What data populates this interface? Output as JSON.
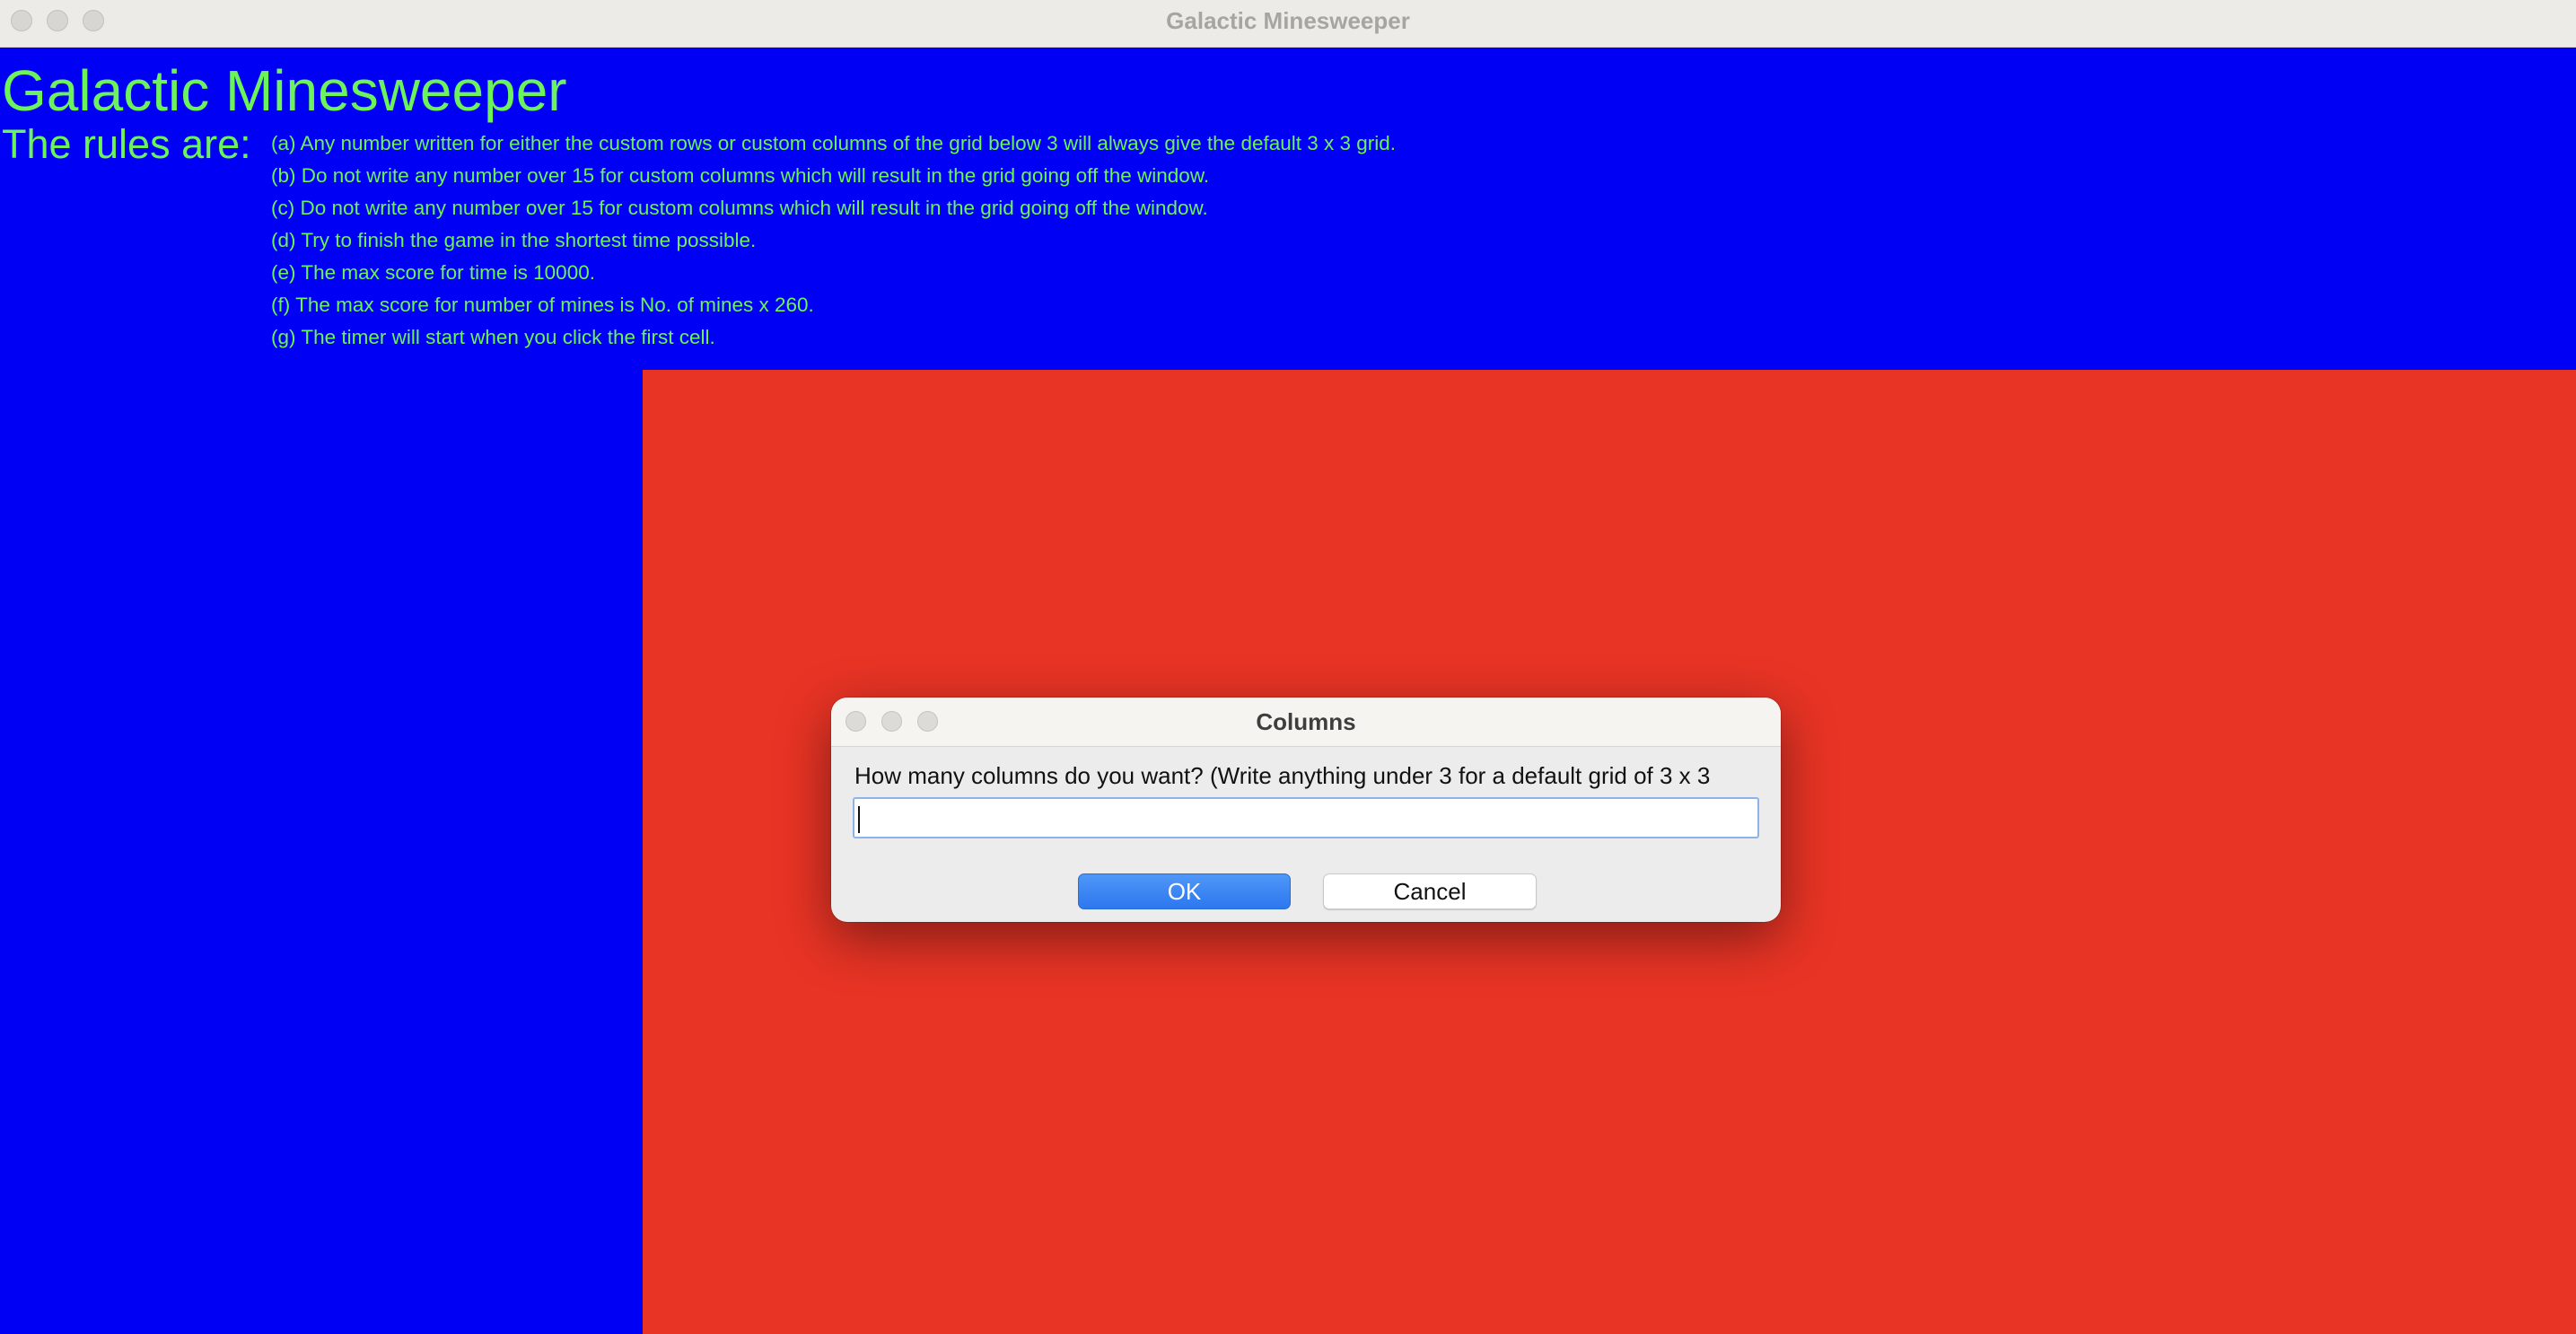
{
  "window": {
    "title": "Galactic Minesweeper"
  },
  "header": {
    "app_title": "Galactic Minesweeper",
    "rules_heading": "The rules are:",
    "rules": [
      "(a) Any number written for either the custom rows or custom columns of the grid below 3 will always give the default 3 x 3 grid.",
      "(b) Do not write any number over 15 for custom columns which will result in the grid going off the window.",
      "(c) Do not write any number over 15 for custom columns which will result in the grid going off the window.",
      "(d) Try to finish the game in the shortest time possible.",
      "(e) The max score for time is 10000.",
      "(f) The max score for number of mines is No. of mines x 260.",
      "(g) The timer will start when you click the first cell."
    ]
  },
  "dialog": {
    "title": "Columns",
    "prompt": "How many columns do you want? (Write anything under 3 for a default grid of 3 x 3",
    "input_value": "",
    "ok_label": "OK",
    "cancel_label": "Cancel"
  },
  "colors": {
    "background": "#0000F5",
    "text_green": "#6CF25A",
    "grid_area": "#E83425",
    "accent_blue": "#2C78EE"
  }
}
